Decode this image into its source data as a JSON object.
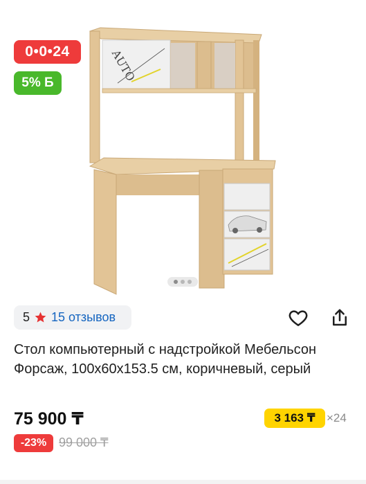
{
  "product": {
    "image_alt": "Стол компьютерный с надстройкой",
    "timer_badge": "0•0•24",
    "bonus_badge": "5% Б",
    "image_decal_text": "AUTO",
    "gallery": {
      "total": 3,
      "active": 0
    },
    "rating": {
      "score": "5",
      "reviews_label": "15 отзывов"
    },
    "title": "Стол компьютерный с надстройкой Мебельсон Форсаж, 100x60x153.5 см, коричневый, серый",
    "price": "75 900 ₸",
    "installment": {
      "amount": "3 163 ₸",
      "times": "×24"
    },
    "discount": "-23%",
    "old_price": "99 000 ₸"
  },
  "colors": {
    "timer_red": "#ee3b3b",
    "bonus_green": "#49b82b",
    "link_blue": "#1565c0",
    "installment_yellow": "#ffd400",
    "wood": "#e2c496",
    "panel_white": "#efefef"
  },
  "icons": {
    "star": "star-icon",
    "favorite": "heart-outline-icon",
    "share": "share-icon"
  }
}
